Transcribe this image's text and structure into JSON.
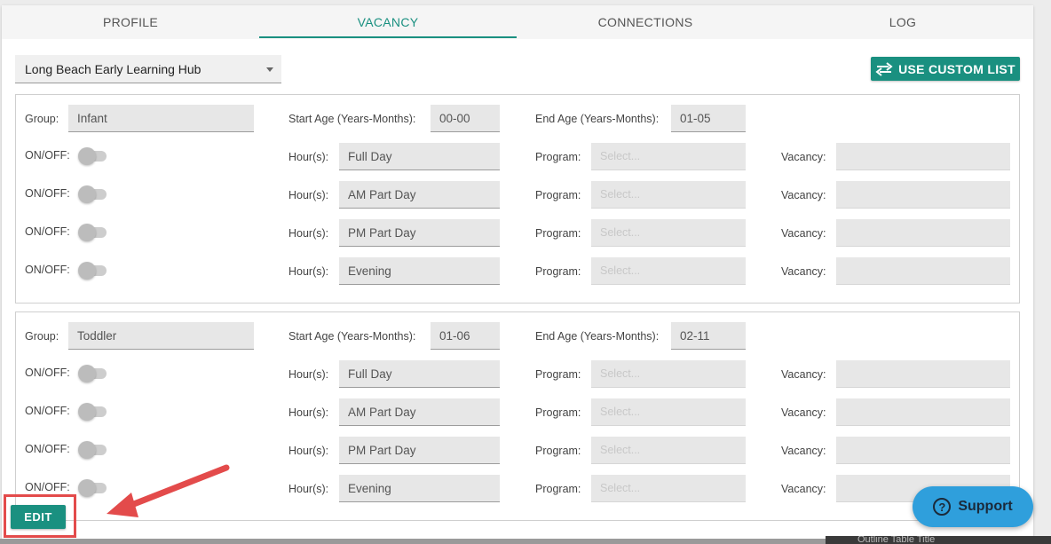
{
  "tabs": [
    {
      "label": "PROFILE",
      "active": false
    },
    {
      "label": "VACANCY",
      "active": true
    },
    {
      "label": "CONNECTIONS",
      "active": false
    },
    {
      "label": "LOG",
      "active": false
    }
  ],
  "site_select": {
    "value": "Long Beach Early Learning Hub"
  },
  "custom_list_button": {
    "label": "USE CUSTOM LIST",
    "icon": "swap-arrows-icon"
  },
  "labels": {
    "group": "Group:",
    "start_age": "Start Age (Years-Months):",
    "end_age": "End Age (Years-Months):",
    "on_off": "ON/OFF:",
    "hours": "Hour(s):",
    "program": "Program:",
    "vacancy": "Vacancy:"
  },
  "groups": [
    {
      "group": "Infant",
      "start_age": "00-00",
      "end_age": "01-05",
      "rows": [
        {
          "on": false,
          "hours": "Full Day",
          "program_placeholder": "Select...",
          "vacancy": ""
        },
        {
          "on": false,
          "hours": "AM Part Day",
          "program_placeholder": "Select...",
          "vacancy": ""
        },
        {
          "on": false,
          "hours": "PM Part Day",
          "program_placeholder": "Select...",
          "vacancy": ""
        },
        {
          "on": false,
          "hours": "Evening",
          "program_placeholder": "Select...",
          "vacancy": ""
        }
      ]
    },
    {
      "group": "Toddler",
      "start_age": "01-06",
      "end_age": "02-11",
      "rows": [
        {
          "on": false,
          "hours": "Full Day",
          "program_placeholder": "Select...",
          "vacancy": ""
        },
        {
          "on": false,
          "hours": "AM Part Day",
          "program_placeholder": "Select...",
          "vacancy": ""
        },
        {
          "on": false,
          "hours": "PM Part Day",
          "program_placeholder": "Select...",
          "vacancy": ""
        },
        {
          "on": false,
          "hours": "Evening",
          "program_placeholder": "Select...",
          "vacancy": ""
        }
      ]
    }
  ],
  "edit_button": {
    "label": "EDIT"
  },
  "support_button": {
    "label": "Support",
    "icon": "help-circle-icon"
  },
  "bottom_text": "Outline Table Title",
  "colors": {
    "accent": "#1a9080",
    "annotation": "#e34b4b",
    "support": "#2f9fdc"
  }
}
